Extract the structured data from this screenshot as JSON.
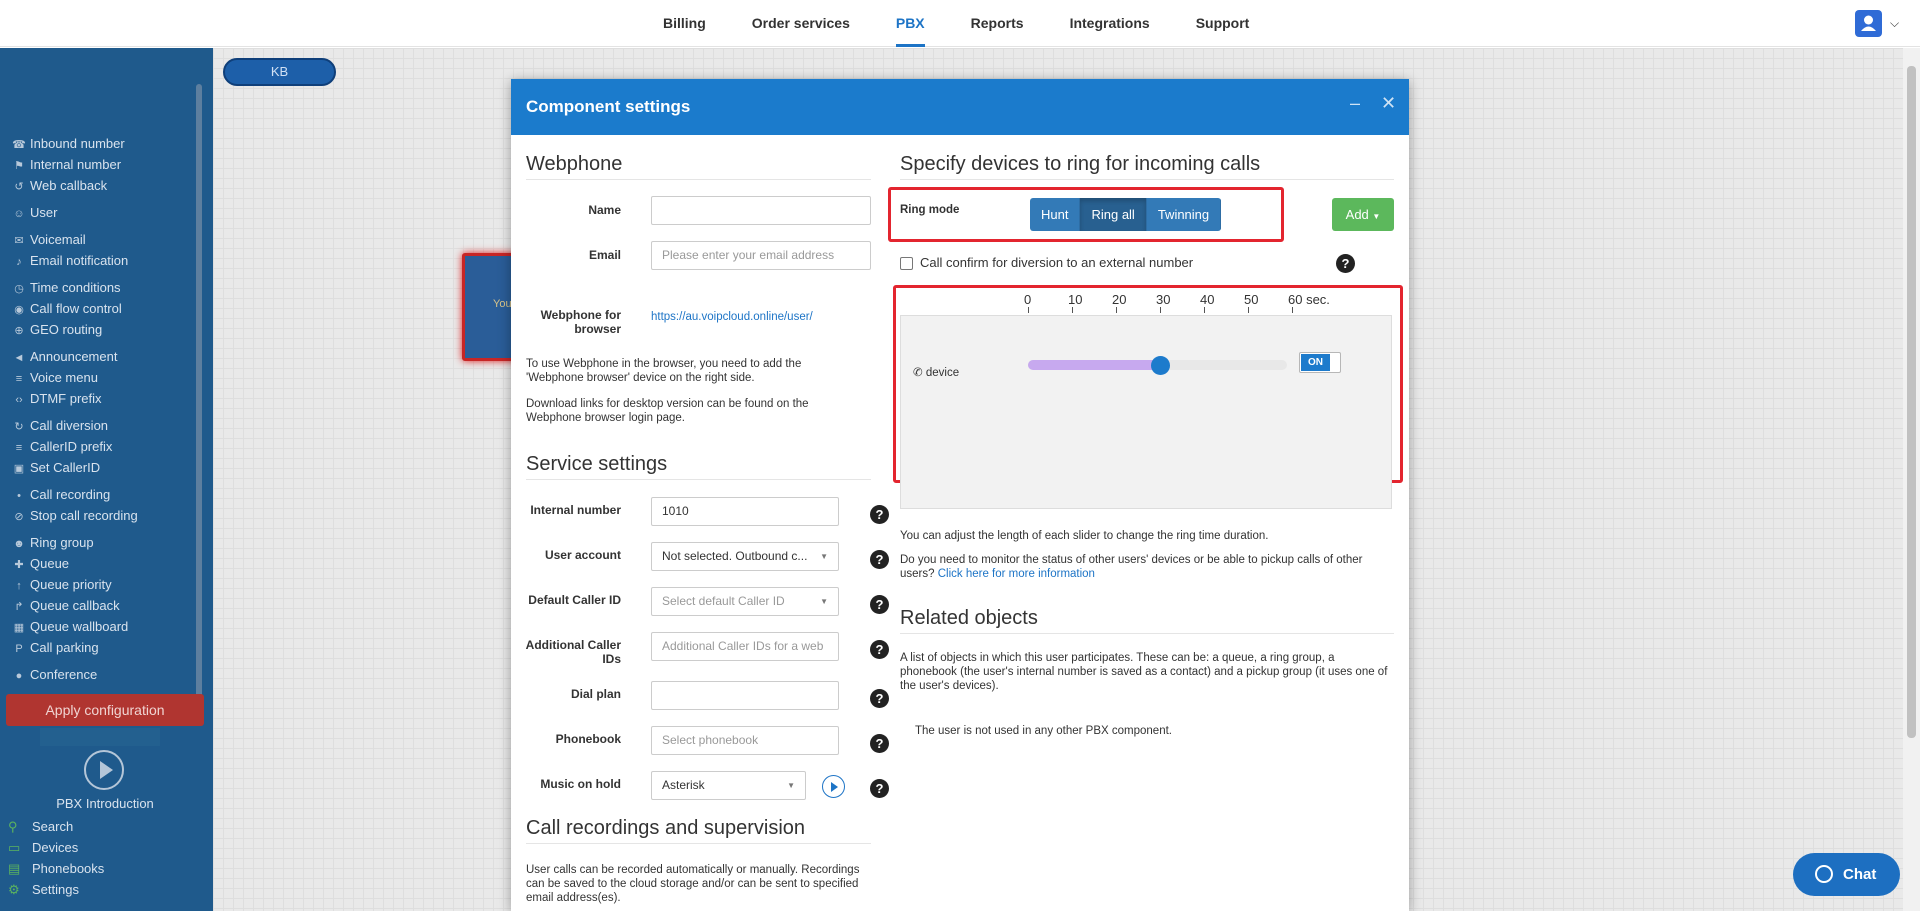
{
  "topnav": {
    "items": [
      "Billing",
      "Order services",
      "PBX",
      "Reports",
      "Integrations",
      "Support"
    ],
    "active": "PBX"
  },
  "sidebar": {
    "items": [
      {
        "label": "Inbound number",
        "icon": "phone-in-icon"
      },
      {
        "label": "Internal number",
        "icon": "map-pin-icon"
      },
      {
        "label": "Web callback",
        "icon": "undo-icon"
      },
      {
        "label": "User",
        "icon": "user-icon"
      },
      {
        "label": "Voicemail",
        "icon": "envelope-icon"
      },
      {
        "label": "Email notification",
        "icon": "bell-icon"
      },
      {
        "label": "Time conditions",
        "icon": "clock-icon"
      },
      {
        "label": "Call flow control",
        "icon": "toggle-icon"
      },
      {
        "label": "GEO routing",
        "icon": "globe-icon"
      },
      {
        "label": "Announcement",
        "icon": "megaphone-icon"
      },
      {
        "label": "Voice menu",
        "icon": "list-icon"
      },
      {
        "label": "DTMF prefix",
        "icon": "code-icon"
      },
      {
        "label": "Call diversion",
        "icon": "refresh-icon"
      },
      {
        "label": "CallerID prefix",
        "icon": "list-icon"
      },
      {
        "label": "Set CallerID",
        "icon": "id-card-icon"
      },
      {
        "label": "Call recording",
        "icon": "microphone-icon"
      },
      {
        "label": "Stop call recording",
        "icon": "microphone-slash-icon"
      },
      {
        "label": "Ring group",
        "icon": "users-icon"
      },
      {
        "label": "Queue",
        "icon": "user-plus-icon"
      },
      {
        "label": "Queue priority",
        "icon": "arrow-up-icon"
      },
      {
        "label": "Queue callback",
        "icon": "share-icon"
      },
      {
        "label": "Queue wallboard",
        "icon": "table-icon"
      },
      {
        "label": "Call parking",
        "icon": "parking-icon"
      },
      {
        "label": "Conference",
        "icon": "comments-icon"
      }
    ],
    "apply_label": "Apply configuration",
    "intro_label": "PBX Introduction",
    "bottom": [
      "Search",
      "Devices",
      "Phonebooks",
      "Settings"
    ]
  },
  "canvas": {
    "kb_label": "KB",
    "node_label": "You"
  },
  "modal": {
    "title": "Component settings",
    "webphone": {
      "title": "Webphone",
      "name_label": "Name",
      "name_value": "",
      "email_label": "Email",
      "email_placeholder": "Please enter your email address",
      "browser_label": "Webphone for browser",
      "browser_link": "https://au.voipcloud.online/user/",
      "note1": "To use Webphone in the browser, you need to add the 'Webphone browser' device on the right side.",
      "note2": "Download links for desktop version can be found on the Webphone browser login page."
    },
    "service": {
      "title": "Service settings",
      "internal_label": "Internal number",
      "internal_value": "1010",
      "account_label": "User account",
      "account_value": "Not selected. Outbound c...",
      "callerid_label": "Default Caller ID",
      "callerid_placeholder": "Select default Caller ID",
      "addcallerid_label": "Additional Caller IDs",
      "addcallerid_placeholder": "Additional Caller IDs for a web",
      "dialplan_label": "Dial plan",
      "phonebook_label": "Phonebook",
      "phonebook_placeholder": "Select phonebook",
      "moh_label": "Music on hold",
      "moh_value": "Asterisk"
    },
    "recordings": {
      "title": "Call recordings and supervision",
      "text": "User calls can be recorded automatically or manually. Recordings can be saved to the cloud storage and/or can be sent to specified email address(es)."
    },
    "devices": {
      "title": "Specify devices to ring for incoming calls",
      "ring_mode_label": "Ring mode",
      "modes": [
        "Hunt",
        "Ring all",
        "Twinning"
      ],
      "active_mode": "Ring all",
      "add_label": "Add",
      "confirm_label": "Call confirm for diversion to an external number",
      "ticks": [
        "0",
        "10",
        "20",
        "30",
        "40",
        "50",
        "60 sec."
      ],
      "device_label": "device",
      "device_ring_seconds": 30,
      "toggle_label": "ON",
      "slider_note": "You can adjust the length of each slider to change the ring time duration.",
      "monitor_note": "Do you need to monitor the status of other users' devices or be able to pickup calls of other users?",
      "monitor_link": "Click here for more information"
    },
    "related": {
      "title": "Related objects",
      "text": "A list of objects in which this user participates. These can be: a queue, a ring group, a phonebook (the user's internal number is saved as a contact) and a pickup group (it uses one of the user's devices).",
      "empty": "The user is not used in any other PBX component."
    }
  },
  "chat_label": "Chat"
}
